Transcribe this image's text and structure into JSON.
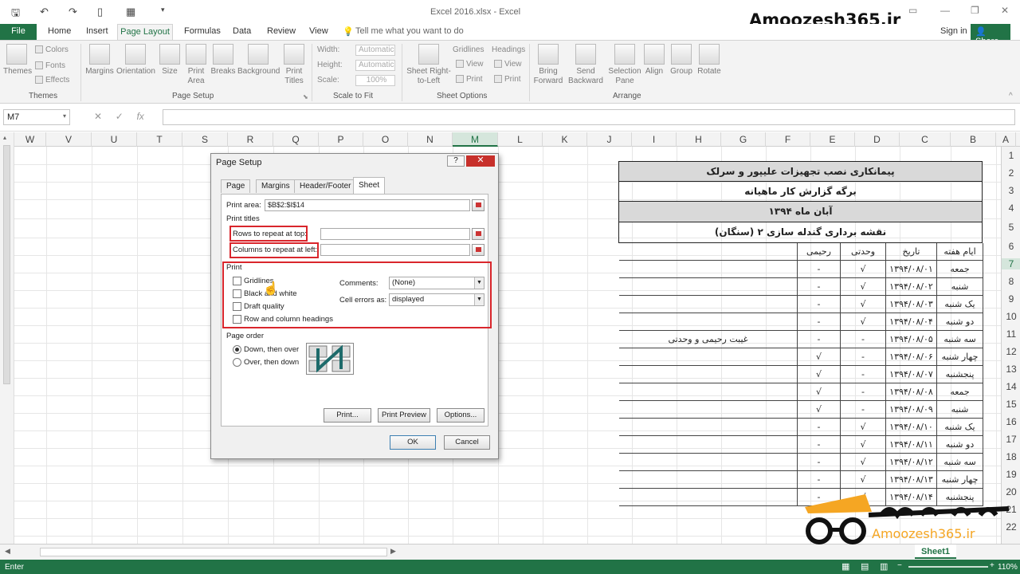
{
  "title_bar": {
    "window_title": "Excel 2016.xlsx - Excel",
    "brand": "Amoozesh365.ir"
  },
  "tabs": {
    "file": "File",
    "items": [
      "Home",
      "Insert",
      "Page Layout",
      "Formulas",
      "Data",
      "Review",
      "View"
    ],
    "tell_me": "Tell me what you want to do",
    "sign_in": "Sign in",
    "share": "Share"
  },
  "ribbon": {
    "themes": {
      "themes": "Themes",
      "colors": "Colors",
      "fonts": "Fonts",
      "effects": "Effects",
      "group": "Themes"
    },
    "page_setup": {
      "margins": "Margins",
      "orientation": "Orientation",
      "size": "Size",
      "print_area": "Print Area",
      "breaks": "Breaks",
      "background": "Background",
      "print_titles": "Print Titles",
      "group": "Page Setup"
    },
    "scale": {
      "width_label": "Width:",
      "width_value": "Automatic",
      "height_label": "Height:",
      "height_value": "Automatic",
      "scale_label": "Scale:",
      "scale_value": "100%",
      "group": "Scale to Fit"
    },
    "sheet_options": {
      "sheet_rtl": "Sheet Right-to-Left",
      "gridlines": "Gridlines",
      "headings": "Headings",
      "view": "View",
      "print": "Print",
      "group": "Sheet Options"
    },
    "arrange": {
      "bring_forward": "Bring Forward",
      "send_backward": "Send Backward",
      "selection_pane": "Selection Pane",
      "align": "Align",
      "group_btn": "Group",
      "rotate": "Rotate",
      "group": "Arrange"
    }
  },
  "formula_bar": {
    "name_box": "M7",
    "fx": "fx",
    "cancel": "✕",
    "enter": "✓"
  },
  "columns": [
    "W",
    "V",
    "U",
    "T",
    "S",
    "R",
    "Q",
    "P",
    "O",
    "N",
    "M",
    "L",
    "K",
    "J",
    "I",
    "H",
    "G",
    "F",
    "E",
    "D",
    "C",
    "B",
    "A"
  ],
  "rows": [
    "1",
    "2",
    "3",
    "4",
    "5",
    "6",
    "7",
    "8",
    "9",
    "10",
    "11",
    "12",
    "13",
    "14",
    "15",
    "16",
    "17",
    "18",
    "19",
    "20",
    "21",
    "22"
  ],
  "report": {
    "title1": "پیمانکاری نصب تجهیزات علیپور و سرلک",
    "title2": "برگه گزارش کار ماهیانه",
    "title3": "آبان ماه ۱۳۹۴",
    "title4": "نقشه برداری گندله سازی ۲ (سنگان)",
    "headers": {
      "day": "ایام هفته",
      "date": "تاریخ",
      "vahdati": "وحدتی",
      "rahimi": "رحیمی"
    },
    "rows": [
      {
        "day": "جمعه",
        "date": "۱۳۹۴/۰۸/۰۱",
        "vahdati": "√",
        "rahimi": "-",
        "note": ""
      },
      {
        "day": "شنبه",
        "date": "۱۳۹۴/۰۸/۰۲",
        "vahdati": "√",
        "rahimi": "-",
        "note": ""
      },
      {
        "day": "یک شنبه",
        "date": "۱۳۹۴/۰۸/۰۳",
        "vahdati": "√",
        "rahimi": "-",
        "note": ""
      },
      {
        "day": "دو شنبه",
        "date": "۱۳۹۴/۰۸/۰۴",
        "vahdati": "√",
        "rahimi": "-",
        "note": ""
      },
      {
        "day": "سه شنبه",
        "date": "۱۳۹۴/۰۸/۰۵",
        "vahdati": "-",
        "rahimi": "-",
        "note": "غیبت رحیمی و وحدتی"
      },
      {
        "day": "چهار شنبه",
        "date": "۱۳۹۴/۰۸/۰۶",
        "vahdati": "-",
        "rahimi": "√",
        "note": ""
      },
      {
        "day": "پنجشنبه",
        "date": "۱۳۹۴/۰۸/۰۷",
        "vahdati": "-",
        "rahimi": "√",
        "note": ""
      },
      {
        "day": "جمعه",
        "date": "۱۳۹۴/۰۸/۰۸",
        "vahdati": "-",
        "rahimi": "√",
        "note": ""
      },
      {
        "day": "شنبه",
        "date": "۱۳۹۴/۰۸/۰۹",
        "vahdati": "-",
        "rahimi": "√",
        "note": ""
      },
      {
        "day": "یک شنبه",
        "date": "۱۳۹۴/۰۸/۱۰",
        "vahdati": "√",
        "rahimi": "-",
        "note": ""
      },
      {
        "day": "دو شنبه",
        "date": "۱۳۹۴/۰۸/۱۱",
        "vahdati": "√",
        "rahimi": "-",
        "note": ""
      },
      {
        "day": "سه شنبه",
        "date": "۱۳۹۴/۰۸/۱۲",
        "vahdati": "√",
        "rahimi": "-",
        "note": ""
      },
      {
        "day": "چهار شنبه",
        "date": "۱۳۹۴/۰۸/۱۳",
        "vahdati": "√",
        "rahimi": "-",
        "note": ""
      },
      {
        "day": "پنجشنبه",
        "date": "۱۳۹۴/۰۸/۱۴",
        "vahdati": "√",
        "rahimi": "-",
        "note": ""
      }
    ]
  },
  "dialog": {
    "title": "Page Setup",
    "help": "?",
    "close": "✕",
    "tabs": [
      "Page",
      "Margins",
      "Header/Footer",
      "Sheet"
    ],
    "print_area_label": "Print area:",
    "print_area_value": "$B$2:$I$14",
    "print_titles_label": "Print titles",
    "rows_repeat_label": "Rows to repeat at top:",
    "cols_repeat_label": "Columns to repeat at left:",
    "print_label": "Print",
    "gridlines": "Gridlines",
    "black_white": "Black and white",
    "draft_quality": "Draft quality",
    "row_col_headings": "Row and column headings",
    "comments_label": "Comments:",
    "comments_value": "(None)",
    "cell_errors_label": "Cell errors as:",
    "cell_errors_value": "displayed",
    "page_order_label": "Page order",
    "down_then_over": "Down, then over",
    "over_then_down": "Over, then down",
    "print_btn": "Print...",
    "print_preview_btn": "Print Preview",
    "options_btn": "Options...",
    "ok": "OK",
    "cancel": "Cancel"
  },
  "sheet_tab": "Sheet1",
  "status": {
    "mode": "Enter",
    "zoom": "110%"
  },
  "logo_text": "Amoozesh365.ir",
  "colors": {
    "accent": "#217346",
    "highlight": "#d9262c"
  }
}
